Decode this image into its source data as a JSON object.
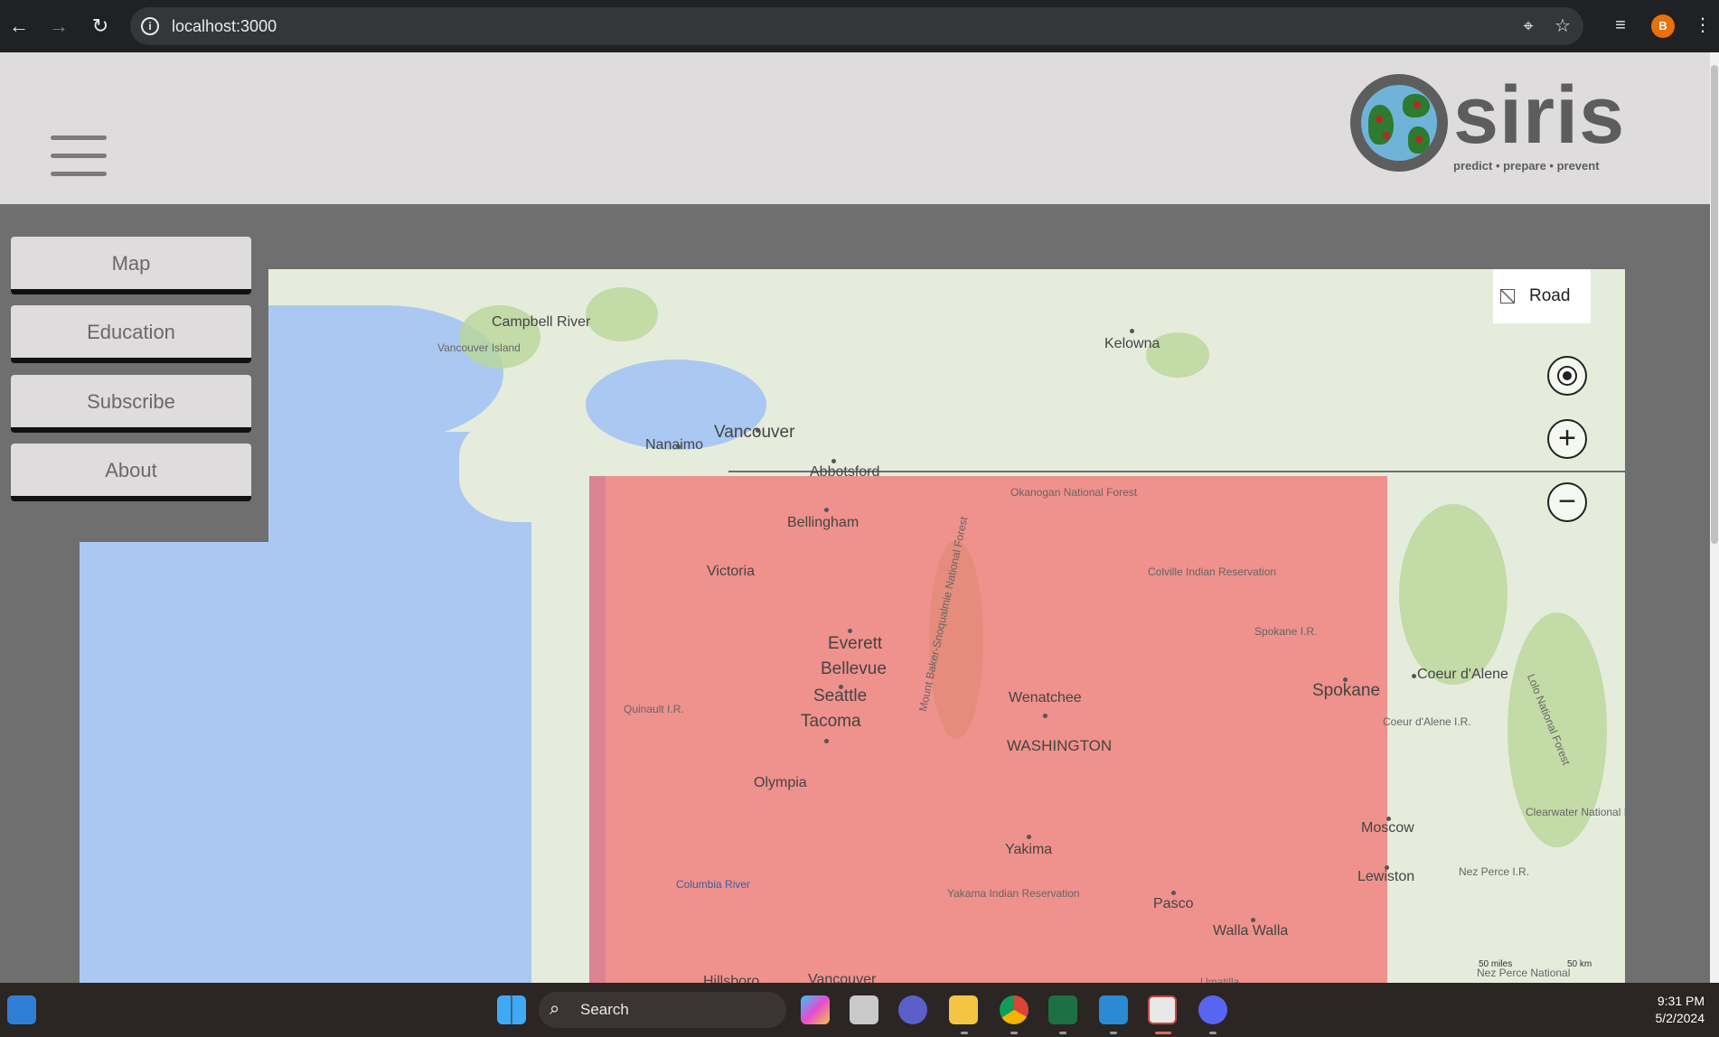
{
  "browser": {
    "url": "localhost:3000",
    "profile_initial": "B",
    "icons": [
      "back-arrow-icon",
      "forward-arrow-icon",
      "reload-icon",
      "site-info-icon",
      "location-icon",
      "bookmark-star-icon",
      "media-playlist-icon",
      "more-menu-icon"
    ]
  },
  "header": {
    "logo_word": "siris",
    "tagline": "predict • prepare • prevent",
    "menu_icon": "hamburger-menu-icon"
  },
  "menu": {
    "items": [
      {
        "label": "Map"
      },
      {
        "label": "Education"
      },
      {
        "label": "Subscribe"
      },
      {
        "label": "About"
      }
    ]
  },
  "map": {
    "layer_toggle": "Road",
    "controls": [
      "locate-icon",
      "zoom-in-icon",
      "zoom-out-icon"
    ],
    "overlay_color": "#f26e6e",
    "labels": {
      "campbell_river": "Campbell River",
      "vancouver_island": "Vancouver Island",
      "kelowna": "Kelowna",
      "nanaimo": "Nanaimo",
      "vancouver": "Vancouver",
      "abbotsford": "Abbotsford",
      "okanogan": "Okanogan National Forest",
      "bellingham": "Bellingham",
      "victoria": "Victoria",
      "colville": "Colville Indian Reservation",
      "everett": "Everett",
      "bellevue": "Bellevue",
      "seattle": "Seattle",
      "tacoma": "Tacoma",
      "spokane_ir": "Spokane I.R.",
      "spokane": "Spokane",
      "coeur_dalene": "Coeur d'Alene",
      "quinault": "Quinault I.R.",
      "wenatchee": "Wenatchee",
      "washington": "WASHINGTON",
      "coeur_dalene_ir": "Coeur d'Alene I.R.",
      "olympia": "Olympia",
      "yakima": "Yakima",
      "moscow": "Moscow",
      "clearwater": "Clearwater National Forest",
      "lewiston": "Lewiston",
      "nez_perce": "Nez Perce I.R.",
      "columbia_river": "Columbia River",
      "yakama": "Yakama Indian Reservation",
      "pasco": "Pasco",
      "walla_walla": "Walla Walla",
      "mt_baker": "Mount Baker-Snoqualmie National Forest",
      "lolo": "Lolo National Forest",
      "hillsboro": "Hillsboro",
      "vancouver_wa": "Vancouver",
      "umatilla": "Umatilla",
      "nez_perce_nf": "Nez Perce National",
      "scale_miles": "50 miles",
      "scale_km": "50 km"
    }
  },
  "taskbar": {
    "search_label": "Search",
    "time": "9:31 PM",
    "date": "5/2/2024",
    "apps": [
      "widgets-icon",
      "windows-start-icon",
      "copilot-icon",
      "task-view-icon",
      "meet-icon",
      "file-explorer-icon",
      "chrome-icon",
      "excel-icon",
      "vscode-icon",
      "snipping-tool-icon",
      "discord-icon"
    ]
  }
}
